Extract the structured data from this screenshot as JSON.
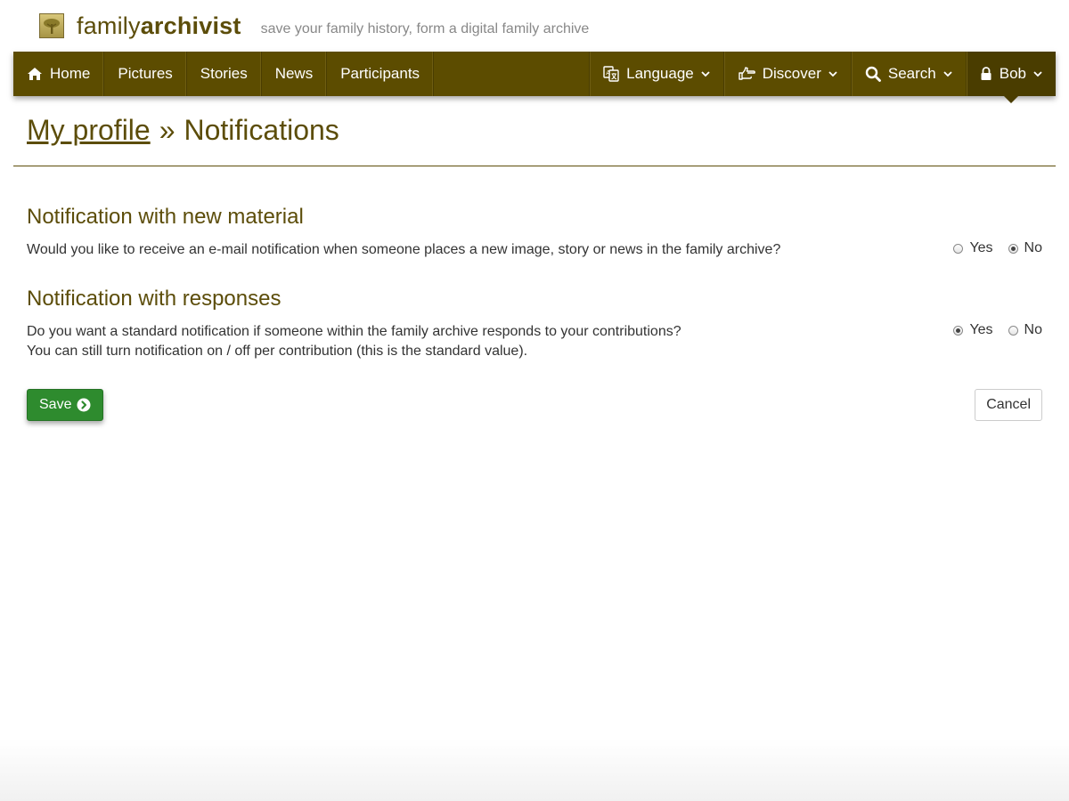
{
  "brand": {
    "name_light": "family",
    "name_bold": "archivist",
    "tagline": "save your family history, form a digital family archive",
    "logo_icon": "tree-icon"
  },
  "nav": {
    "left": [
      {
        "label": "Home",
        "icon": "home-icon"
      },
      {
        "label": "Pictures"
      },
      {
        "label": "Stories"
      },
      {
        "label": "News"
      },
      {
        "label": "Participants"
      }
    ],
    "right": [
      {
        "label": "Language",
        "icon": "translate-icon"
      },
      {
        "label": "Discover",
        "icon": "hand-pointing-icon"
      },
      {
        "label": "Search",
        "icon": "search-icon"
      },
      {
        "label": "Bob",
        "icon": "lock-icon",
        "active": true
      }
    ]
  },
  "page": {
    "breadcrumb_link": "My profile",
    "separator": "»",
    "title": "Notifications"
  },
  "sections": [
    {
      "heading": "Notification with new material",
      "text_lines": [
        "Would you like to receive an e-mail notification when someone places a new image, story or news in the family archive?"
      ],
      "options": [
        "Yes",
        "No"
      ],
      "selected": "No"
    },
    {
      "heading": "Notification with responses",
      "text_lines": [
        "Do you want a standard notification if someone within the family archive responds to your contributions?",
        "You can still turn notification on / off per contribution (this is the standard value)."
      ],
      "options": [
        "Yes",
        "No"
      ],
      "selected": "Yes"
    }
  ],
  "buttons": {
    "save": "Save",
    "cancel": "Cancel"
  },
  "colors": {
    "brand": "#5c4d0a",
    "navbar": "#5c4c00",
    "save_button": "#2e8b2e"
  }
}
